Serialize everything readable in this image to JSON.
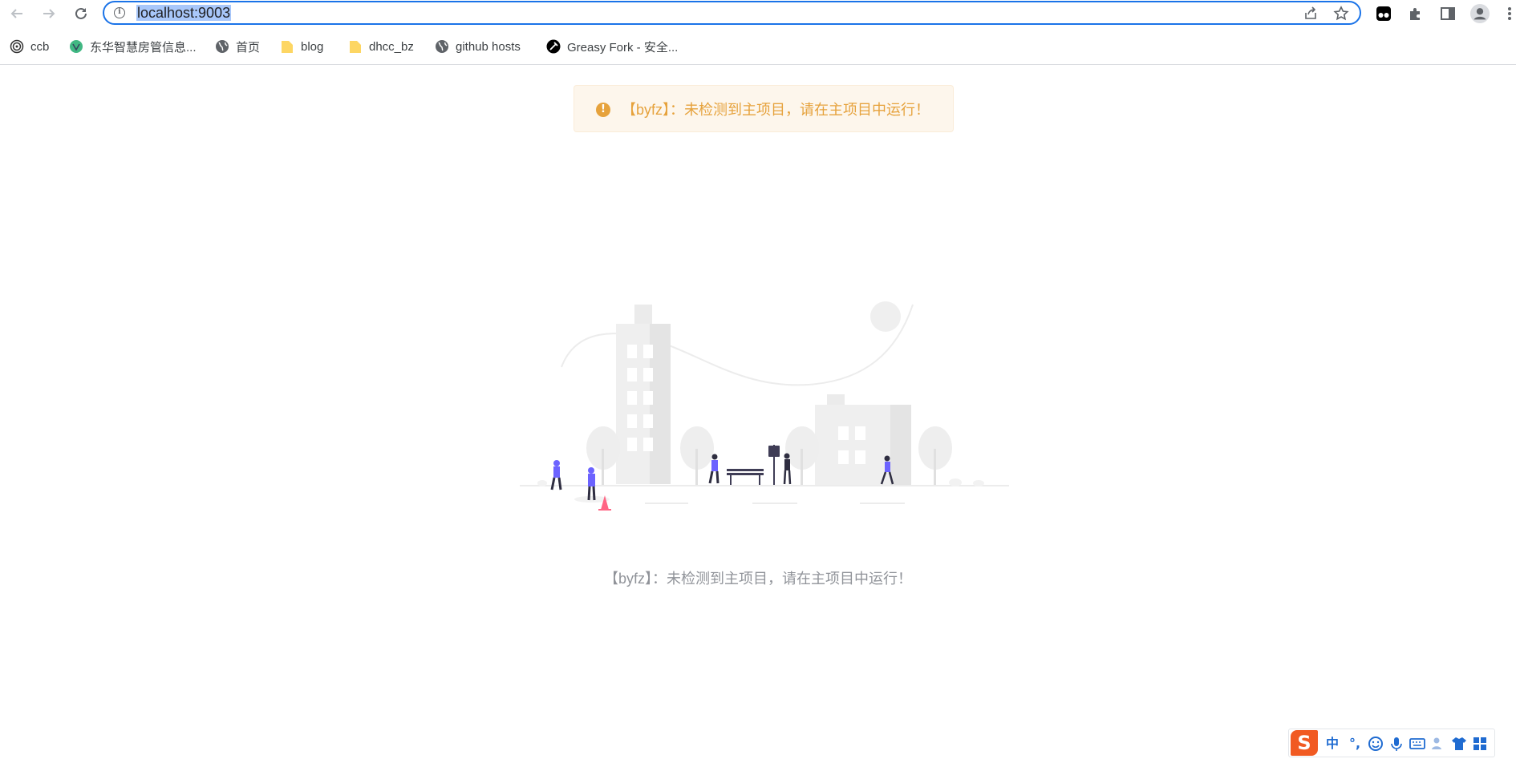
{
  "browser": {
    "url": "localhost:9003",
    "nav": {
      "back": "←",
      "forward": "→",
      "reload": "↻"
    }
  },
  "bookmarks": [
    {
      "label": "ccb",
      "icon": "spiral-icon"
    },
    {
      "label": "东华智慧房管信息...",
      "icon": "vue-logo-icon"
    },
    {
      "label": "首页",
      "icon": "globe-icon"
    },
    {
      "label": "blog",
      "icon": "folder-icon"
    },
    {
      "label": "dhcc_bz",
      "icon": "folder-icon"
    },
    {
      "label": "github hosts",
      "icon": "globe-icon"
    },
    {
      "label": "Greasy Fork - 安全...",
      "icon": "greasyfork-icon"
    }
  ],
  "alert": {
    "type": "warning",
    "message": "【byfz】：未检测到主项目，请在主项目中运行！",
    "color": "#e6a23c"
  },
  "empty": {
    "description": "【byfz】：未检测到主项目，请在主项目中运行！"
  },
  "ime": {
    "logo": "S",
    "mode": "中",
    "punct": "°,"
  },
  "colors": {
    "accent": "#1a73e8",
    "warning": "#e6a23c",
    "figure": "#6c63ff"
  }
}
